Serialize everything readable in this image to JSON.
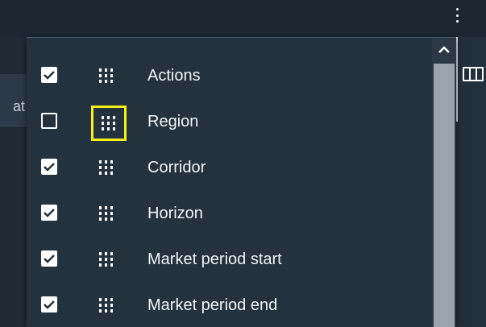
{
  "left_column": {
    "cutoff_text": "at"
  },
  "columns_panel": {
    "items": [
      {
        "label": "Actions",
        "checked": true
      },
      {
        "label": "Region",
        "checked": false
      },
      {
        "label": "Corridor",
        "checked": true
      },
      {
        "label": "Horizon",
        "checked": true
      },
      {
        "label": "Market period start",
        "checked": true
      },
      {
        "label": "Market period end",
        "checked": true
      }
    ]
  },
  "icons": {
    "menu": "more-vertical-icon",
    "drag": "drag-handle-icon",
    "check": "check-icon",
    "columns": "columns-icon",
    "scroll_up": "chevron-up-icon"
  },
  "colors": {
    "highlight": "#f2f01a",
    "background": "#24323d",
    "text": "#f1f4f6"
  }
}
